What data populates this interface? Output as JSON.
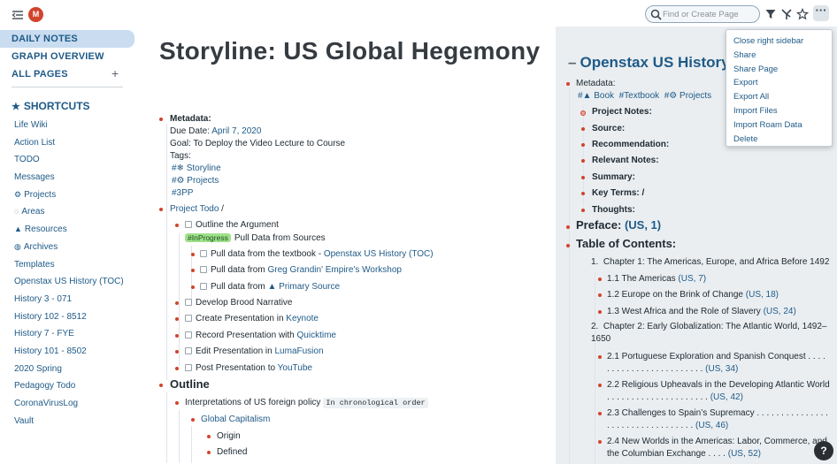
{
  "sidebar": {
    "avatar_letter": "M",
    "nav": {
      "daily_notes": "DAILY NOTES",
      "graph_overview": "GRAPH OVERVIEW",
      "all_pages": "ALL PAGES",
      "add": "+"
    },
    "shortcuts_label": "SHORTCUTS",
    "shortcuts": [
      {
        "icon": "",
        "label": "Life Wiki"
      },
      {
        "icon": "",
        "label": "Action List"
      },
      {
        "icon": "",
        "label": "TODO"
      },
      {
        "icon": "",
        "label": "Messages"
      },
      {
        "icon": "⚙",
        "label": "Projects"
      },
      {
        "icon": "◌",
        "label": "Areas"
      },
      {
        "icon": "▲",
        "label": "Resources"
      },
      {
        "icon": "◍",
        "label": "Archives"
      },
      {
        "icon": "",
        "label": "Templates"
      },
      {
        "icon": "",
        "label": "Openstax US History (TOC)"
      },
      {
        "icon": "",
        "label": "History 3 - 071"
      },
      {
        "icon": "",
        "label": "History 102 - 8512"
      },
      {
        "icon": "",
        "label": "History 7 - FYE"
      },
      {
        "icon": "",
        "label": "History 101 - 8502"
      },
      {
        "icon": "",
        "label": "2020 Spring"
      },
      {
        "icon": "",
        "label": "Pedagogy Todo"
      },
      {
        "icon": "",
        "label": "CoronaVirusLog"
      },
      {
        "icon": "",
        "label": "Vault"
      }
    ]
  },
  "topbar": {
    "search_placeholder": "Find or Create Page",
    "more": "···"
  },
  "main": {
    "title": "Storyline: US Global Hegemony",
    "metadata_label": "Metadata:",
    "due_label": "Due Date:",
    "due_value": "April 7, 2020",
    "goal": "Goal: To Deploy the Video Lecture to Course",
    "tags_label": "Tags:",
    "tags": [
      "#❄ Storyline",
      "#⚙ Projects",
      "#3PP"
    ],
    "project_todo": "Project Todo",
    "project_todo_suffix": " /",
    "tasks": {
      "outline_argument": "Outline the Argument",
      "inprogress_tag": "#InProgress",
      "pull_sources": "Pull Data from Sources",
      "pull1_prefix": "Pull data from the textbook - ",
      "pull1_link": "Openstax US History (TOC)",
      "pull2_prefix": "Pull data from ",
      "pull2_link": "Greg Grandin' Empire's Workshop",
      "pull3_prefix": "Pull data from ",
      "pull3_link": "▲ Primary Source",
      "broad": "Develop Brood Narrative",
      "create_prefix": "Create Presentation in ",
      "create_link": "Keynote",
      "record_prefix": "Record Presentation with ",
      "record_link": "Quicktime",
      "edit_prefix": "Edit Presentation in ",
      "edit_link": "LumaFusion",
      "post_prefix": "Post Presentation to ",
      "post_link": "YouTube"
    },
    "outline_heading": "Outline",
    "interp": "Interpretations of US foreign policy",
    "interp_code": "In chronological order",
    "global_cap": "Global Capitalism",
    "origin": "Origin",
    "defined": "Defined"
  },
  "right_sidebar": {
    "title": "Openstax US History (",
    "metadata_label": "Metadata:",
    "tags": [
      "#▲ Book",
      "#Textbook",
      "#⚙ Projects"
    ],
    "fields": [
      "Project Notes:",
      "Source:",
      "Recommendation:",
      "Relevant Notes:",
      "Summary:",
      "Key Terms: /",
      "Thoughts:"
    ],
    "preface_label": "Preface:",
    "preface_ref": "(US, 1)",
    "toc_label": "Table of Contents:",
    "chapter1_num": "1.",
    "chapter1": "Chapter 1: The Americas, Europe, and Africa Before 1492",
    "ch1_items": [
      {
        "text": "1.1 The Americas ",
        "ref": "(US, 7)"
      },
      {
        "text": "1.2 Europe on the Brink of Change ",
        "ref": "(US, 18)"
      },
      {
        "text": "1.3 West Africa and the Role of Slavery ",
        "ref": "(US, 24)"
      }
    ],
    "chapter2_num": "2.",
    "chapter2": "Chapter 2: Early Globalization: The Atlantic World, 1492–1650",
    "ch2_items": [
      {
        "text": "2.1 Portuguese Exploration and Spanish Conquest . . . . . . . . . . . . . . . . . . . . . . . . ",
        "ref": "(US, 34)"
      },
      {
        "text": "2.2 Religious Upheavals in the Developing Atlantic World . . . . . . . . . . . . . . . . . . . . . ",
        "ref": "(US, 42)"
      },
      {
        "text": "2.3 Challenges to Spain’s Supremacy . . . . . . . . . . . . . . . . . . . . . . . . . . . . . . . . . ",
        "ref": "(US, 46)"
      },
      {
        "text": "2.4 New Worlds in the Americas: Labor, Commerce, and the Columbian Exchange . . . . ",
        "ref": "(US, 52)"
      }
    ]
  },
  "menu": {
    "items": [
      "Close right sidebar",
      "Share",
      "Share Page",
      "Export",
      "Export All",
      "Import Files",
      "Import Roam Data",
      "Delete"
    ]
  },
  "help": "?",
  "colors": {
    "accent": "#1f5a87",
    "bullet": "#d1432c",
    "nav_active": "#c9dcf0",
    "right_sidebar_bg": "#eaeef1",
    "inprogress": "#9fe08a"
  }
}
